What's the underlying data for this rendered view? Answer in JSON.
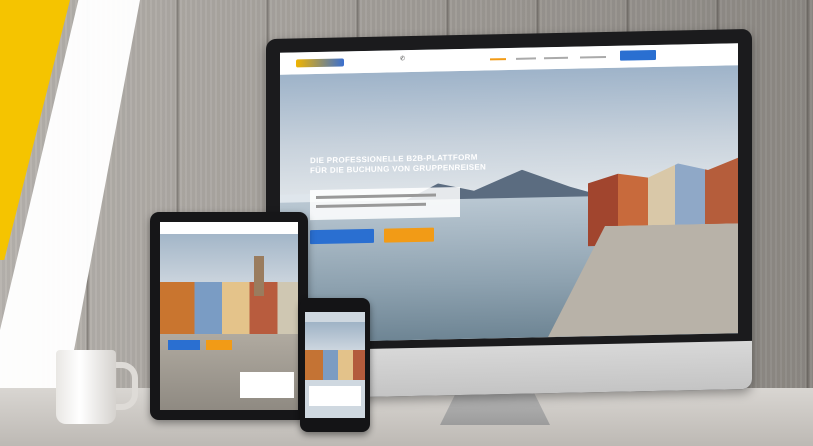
{
  "scene": {
    "description_tags": [
      "desktop-monitor",
      "tablet",
      "smartphone",
      "coffee-mug",
      "wooden-wall"
    ],
    "accent_colors": {
      "yellow_band": "#f5c400",
      "primary_button": "#2a6fd1",
      "secondary_button": "#f29b16"
    }
  },
  "monitor_site": {
    "hero_title_line1": "DIE PROFESSIONELLE B2B-PLATTFORM",
    "hero_title_line2": "FÜR DIE BUCHUNG VON GRUPPENREISEN"
  }
}
